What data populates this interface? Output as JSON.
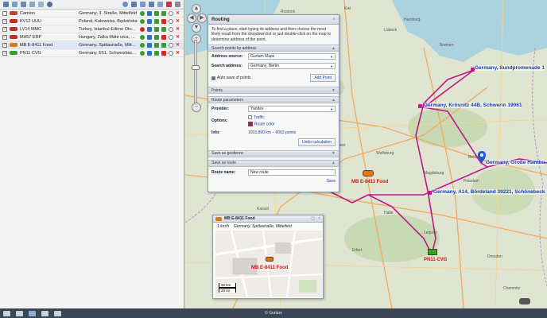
{
  "units": [
    {
      "name": "Camion",
      "address": "Germany, 3. Straße, Mittelfeld",
      "color": "#c0462a",
      "checked": false
    },
    {
      "name": "KV12 UUU",
      "address": "Poland, Katowicka, Będzińska",
      "color": "#b83226",
      "checked": true
    },
    {
      "name": "LV14 MMC",
      "address": "Turkey, İstanbul-Edirne Otoyolu",
      "color": "#b83226",
      "checked": true
    },
    {
      "name": "MA57 ERP",
      "address": "Hungary, Zalka Máté utca, N...",
      "color": "#b83226",
      "checked": true
    },
    {
      "name": "MB E-8411 Food",
      "address": "Germany, Spittastraße, Mittel...",
      "color": "#d97a1a",
      "checked": true,
      "selected": true
    },
    {
      "name": "PN11 CVG",
      "address": "Germany, E51, Schweizbachs...",
      "color": "#3a9e2a",
      "checked": true
    }
  ],
  "routing": {
    "title": "Routing",
    "close": "×",
    "description": "To find a place, start typing its address and then choose the most likely result from the dropdown list or just double-click on the map to determine address of the point.",
    "sections": {
      "search": "Search points by address",
      "points": "Points",
      "params": "Route parameters",
      "geofence": "Save as geofence",
      "save_route": "Save as route"
    },
    "address_source_label": "Address source:",
    "address_source_value": "Gurtam Maps",
    "search_address_label": "Search address:",
    "search_address_value": "Germany, Berlin",
    "autosave_label": "Auto save of points",
    "add_point": "Add Point",
    "provider_label": "Provider:",
    "provider_value": "Yandex",
    "options_label": "Options:",
    "traffic_label": "Traffic",
    "route_color_label": "Route color",
    "info_label": "Info:",
    "info_value": "1033.890 km – 6063 points",
    "undo": "Undo calculation",
    "route_name_label": "Route name:",
    "route_name_value": "New route",
    "save": "Save"
  },
  "map": {
    "labels": {
      "sundpromenade": "Germany, Sundpromenade 1",
      "schwerin": "Germany, Krösnitz 44B, Schwerin 19061",
      "hamburg": "Germany, Große Hambu",
      "bordeland": "Germany, A14, Bördeland 39221, Schönebeck",
      "vehicle_mb": "MB E-8411 Food",
      "vehicle_pn": "PN11 CVG"
    },
    "towns": [
      "Rostock",
      "Hamburg",
      "Bremen",
      "Berlin",
      "Hannover",
      "Magdeburg",
      "Leipzig",
      "Dresden",
      "Kassel",
      "Erfurt",
      "Bielefeld",
      "Halle",
      "Lübeck",
      "Kiel",
      "Potsdam",
      "Wolfsburg",
      "Göttingen",
      "Chemnitz"
    ]
  },
  "popup": {
    "title": "MB E-8411 Food",
    "time": "1 km/h",
    "address": "Germany, Spittastraße, Mittelfeld",
    "vehicle_label": "MB E-8411 Food",
    "scale_km": "50 km",
    "scale_mi": "20 mi"
  },
  "footer": {
    "copyright": "© Gurtam"
  }
}
